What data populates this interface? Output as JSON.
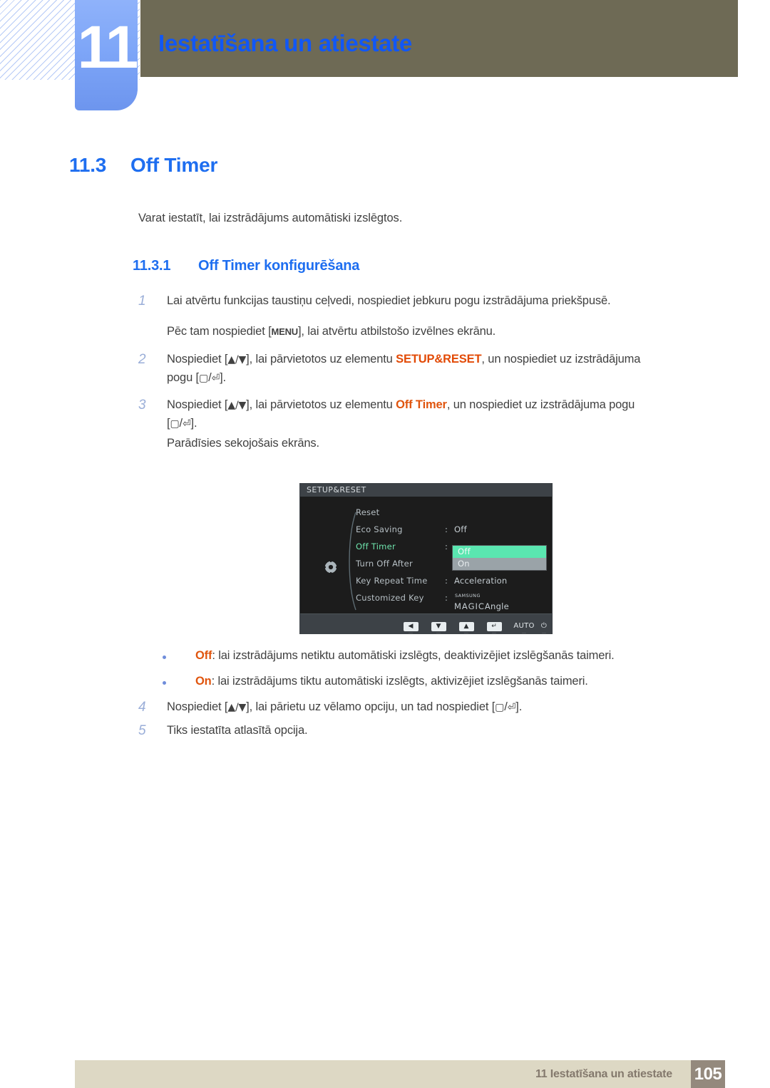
{
  "chapter": {
    "number": "11",
    "title": "Iestatīšana un atiestate"
  },
  "section": {
    "number": "11.3",
    "title": "Off Timer",
    "intro": "Varat iestatīt, lai izstrādājums automātiski izslēgtos."
  },
  "subsection": {
    "number": "11.3.1",
    "title": "Off Timer konfigurēšana"
  },
  "steps": [
    {
      "num": "1",
      "text_before": "Lai atvērtu funkcijas taustiņu ceļvedi, nospiediet jebkuru pogu izstrādājuma priekšpusē."
    },
    {
      "num": "2",
      "part1": "Nospiediet [",
      "keys": "▲/▼",
      "part2": "], lai pārvietotos uz elementu ",
      "highlight": "SETUP&RESET",
      "part3": ", un nospiediet uz izstrādājuma",
      "part4": "pogu [",
      "part5": "]."
    },
    {
      "num": "3",
      "part1": "Nospiediet [",
      "keys": "▲/▼",
      "part2": "], lai pārvietotos uz elementu ",
      "highlight": "Off Timer",
      "part3": ", un nospiediet uz izstrādājuma pogu",
      "part4": "[",
      "part5": "]."
    },
    {
      "num": "4",
      "part1": "Nospiediet [",
      "keys": "▲/▼",
      "part2": "], lai pārietu uz vēlamo opciju, un tad nospiediet [",
      "part3": "]."
    },
    {
      "num": "5",
      "text_before": "Tiks iestatīta atlasītā opcija."
    }
  ],
  "notes": {
    "menu_line_part1": "Pēc tam nospiediet [",
    "menu_key": "MENU",
    "menu_line_part2": "], lai atvērtu atbilstošo izvēlnes ekrānu.",
    "screen_appears": "Parādīsies sekojošais ekrāns."
  },
  "bullets": [
    {
      "label": "Off",
      "text": ": lai izstrādājums netiktu automātiski izslēgts, deaktivizējiet izslēgšanās taimeri."
    },
    {
      "label": "On",
      "text": ": lai izstrādājums tiktu automātiski izslēgts, aktivizējiet izslēgšanās taimeri."
    }
  ],
  "osd": {
    "title": "SETUP&RESET",
    "gear_icon": "gear-icon",
    "menu_items": [
      {
        "label": "Reset",
        "value": "",
        "has_colon": false,
        "active": false
      },
      {
        "label": "Eco Saving",
        "value": "Off",
        "has_colon": true,
        "active": false
      },
      {
        "label": "Off Timer",
        "value": "",
        "has_colon": true,
        "active": true
      },
      {
        "label": "Turn Off After",
        "value": "",
        "has_colon": false,
        "active": false
      },
      {
        "label": "Key Repeat Time",
        "value": "Acceleration",
        "has_colon": true,
        "active": false
      },
      {
        "label": "Customized Key",
        "value": "",
        "has_colon": true,
        "active": false
      }
    ],
    "dropdown": {
      "selected": "Off",
      "unselected": "On"
    },
    "magic": {
      "brand": "SAMSUNG",
      "main": "MAGIC",
      "suffix": "Angle"
    },
    "footer_buttons": [
      {
        "glyph": "◀",
        "name": "left-arrow-button"
      },
      {
        "glyph": "▼",
        "name": "down-arrow-button"
      },
      {
        "glyph": "▲",
        "name": "up-arrow-button"
      },
      {
        "glyph": "↵",
        "name": "enter-button"
      },
      {
        "glyph": "AUTO",
        "name": "auto-button"
      },
      {
        "glyph": "⏻",
        "name": "power-button"
      }
    ],
    "tick_glyph": "▼"
  },
  "footer": {
    "text": "11 Iestatīšana un atiestate",
    "page_number": "105"
  },
  "colors": {
    "accent_blue": "#1e6ef0",
    "header_olive": "#6e6a55",
    "tab_blue": "#7ea6f8",
    "highlight_orange": "#e24a06",
    "osd_green": "#5ae6b0",
    "footer_beige": "#ddd8c4",
    "page_box_brown": "#94897d"
  }
}
